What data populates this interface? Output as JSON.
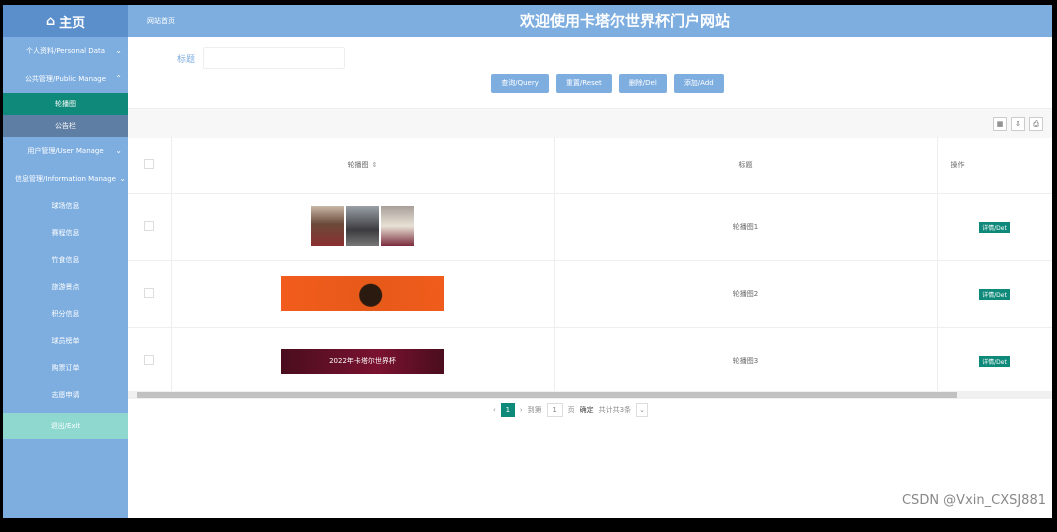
{
  "brand": {
    "icon": "home-icon",
    "label": "主页"
  },
  "header": {
    "crumb": "网站首页",
    "title": "欢迎使用卡塔尔世界杯门户网站"
  },
  "sidebar": {
    "personal": "个人资料/Personal Data",
    "public": "公共管理/Public Manage",
    "public_subs": [
      "轮播图",
      "公告栏"
    ],
    "user": "用户管理/User Manage",
    "info": "信息管理/Information Manage",
    "info_items": [
      "球场信息",
      "赛程信息",
      "竹食信息",
      "旅游景点",
      "积分信息",
      "球员榜单",
      "购票订单",
      "志愿申请"
    ],
    "logout": "退出/Exit"
  },
  "search": {
    "label": "标题",
    "placeholder": ""
  },
  "buttons": {
    "query": "查询/Query",
    "reset": "重置/Reset",
    "delete": "删除/Del",
    "add": "添加/Add"
  },
  "table": {
    "headers": {
      "image": "轮播图",
      "title": "标题",
      "action": "操作"
    },
    "rows": [
      {
        "title": "轮播图1",
        "action": "详情/Det"
      },
      {
        "title": "轮播图2",
        "action": "详情/Det"
      },
      {
        "title": "轮播图3",
        "action": "详情/Det",
        "banner_text": "2022年卡塔尔世界杯"
      }
    ]
  },
  "pager": {
    "current": "1",
    "goto_label": "到第",
    "goto_value": "1",
    "page_unit": "页",
    "confirm": "确定",
    "total": "共计共3条"
  },
  "watermark": "CSDN @Vxin_CXSJ881",
  "colors": {
    "sidebar": "#7eaee0",
    "active": "#0f8a7a",
    "logout": "#8ed8d0"
  }
}
